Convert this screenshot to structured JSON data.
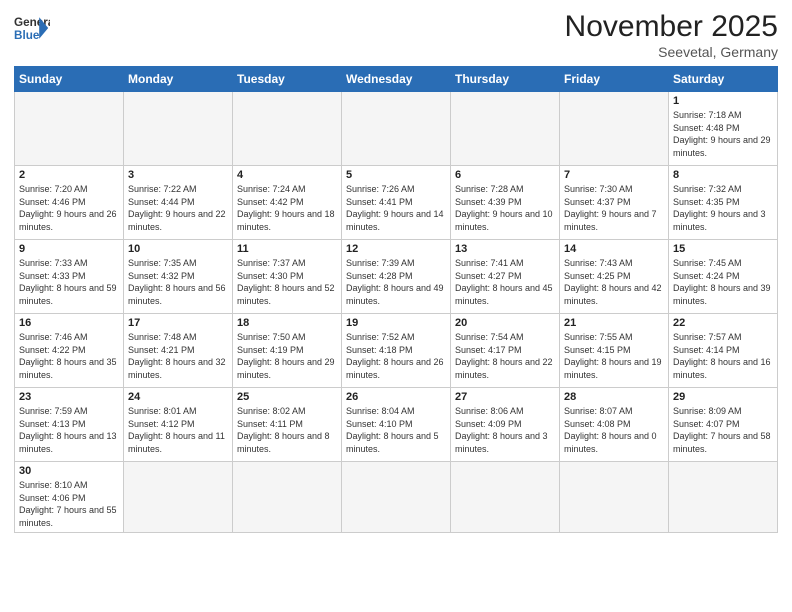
{
  "header": {
    "logo_general": "General",
    "logo_blue": "Blue",
    "month_title": "November 2025",
    "location": "Seevetal, Germany"
  },
  "days_of_week": [
    "Sunday",
    "Monday",
    "Tuesday",
    "Wednesday",
    "Thursday",
    "Friday",
    "Saturday"
  ],
  "weeks": [
    [
      {
        "day": "",
        "info": ""
      },
      {
        "day": "",
        "info": ""
      },
      {
        "day": "",
        "info": ""
      },
      {
        "day": "",
        "info": ""
      },
      {
        "day": "",
        "info": ""
      },
      {
        "day": "",
        "info": ""
      },
      {
        "day": "1",
        "info": "Sunrise: 7:18 AM\nSunset: 4:48 PM\nDaylight: 9 hours and 29 minutes."
      }
    ],
    [
      {
        "day": "2",
        "info": "Sunrise: 7:20 AM\nSunset: 4:46 PM\nDaylight: 9 hours and 26 minutes."
      },
      {
        "day": "3",
        "info": "Sunrise: 7:22 AM\nSunset: 4:44 PM\nDaylight: 9 hours and 22 minutes."
      },
      {
        "day": "4",
        "info": "Sunrise: 7:24 AM\nSunset: 4:42 PM\nDaylight: 9 hours and 18 minutes."
      },
      {
        "day": "5",
        "info": "Sunrise: 7:26 AM\nSunset: 4:41 PM\nDaylight: 9 hours and 14 minutes."
      },
      {
        "day": "6",
        "info": "Sunrise: 7:28 AM\nSunset: 4:39 PM\nDaylight: 9 hours and 10 minutes."
      },
      {
        "day": "7",
        "info": "Sunrise: 7:30 AM\nSunset: 4:37 PM\nDaylight: 9 hours and 7 minutes."
      },
      {
        "day": "8",
        "info": "Sunrise: 7:32 AM\nSunset: 4:35 PM\nDaylight: 9 hours and 3 minutes."
      }
    ],
    [
      {
        "day": "9",
        "info": "Sunrise: 7:33 AM\nSunset: 4:33 PM\nDaylight: 8 hours and 59 minutes."
      },
      {
        "day": "10",
        "info": "Sunrise: 7:35 AM\nSunset: 4:32 PM\nDaylight: 8 hours and 56 minutes."
      },
      {
        "day": "11",
        "info": "Sunrise: 7:37 AM\nSunset: 4:30 PM\nDaylight: 8 hours and 52 minutes."
      },
      {
        "day": "12",
        "info": "Sunrise: 7:39 AM\nSunset: 4:28 PM\nDaylight: 8 hours and 49 minutes."
      },
      {
        "day": "13",
        "info": "Sunrise: 7:41 AM\nSunset: 4:27 PM\nDaylight: 8 hours and 45 minutes."
      },
      {
        "day": "14",
        "info": "Sunrise: 7:43 AM\nSunset: 4:25 PM\nDaylight: 8 hours and 42 minutes."
      },
      {
        "day": "15",
        "info": "Sunrise: 7:45 AM\nSunset: 4:24 PM\nDaylight: 8 hours and 39 minutes."
      }
    ],
    [
      {
        "day": "16",
        "info": "Sunrise: 7:46 AM\nSunset: 4:22 PM\nDaylight: 8 hours and 35 minutes."
      },
      {
        "day": "17",
        "info": "Sunrise: 7:48 AM\nSunset: 4:21 PM\nDaylight: 8 hours and 32 minutes."
      },
      {
        "day": "18",
        "info": "Sunrise: 7:50 AM\nSunset: 4:19 PM\nDaylight: 8 hours and 29 minutes."
      },
      {
        "day": "19",
        "info": "Sunrise: 7:52 AM\nSunset: 4:18 PM\nDaylight: 8 hours and 26 minutes."
      },
      {
        "day": "20",
        "info": "Sunrise: 7:54 AM\nSunset: 4:17 PM\nDaylight: 8 hours and 22 minutes."
      },
      {
        "day": "21",
        "info": "Sunrise: 7:55 AM\nSunset: 4:15 PM\nDaylight: 8 hours and 19 minutes."
      },
      {
        "day": "22",
        "info": "Sunrise: 7:57 AM\nSunset: 4:14 PM\nDaylight: 8 hours and 16 minutes."
      }
    ],
    [
      {
        "day": "23",
        "info": "Sunrise: 7:59 AM\nSunset: 4:13 PM\nDaylight: 8 hours and 13 minutes."
      },
      {
        "day": "24",
        "info": "Sunrise: 8:01 AM\nSunset: 4:12 PM\nDaylight: 8 hours and 11 minutes."
      },
      {
        "day": "25",
        "info": "Sunrise: 8:02 AM\nSunset: 4:11 PM\nDaylight: 8 hours and 8 minutes."
      },
      {
        "day": "26",
        "info": "Sunrise: 8:04 AM\nSunset: 4:10 PM\nDaylight: 8 hours and 5 minutes."
      },
      {
        "day": "27",
        "info": "Sunrise: 8:06 AM\nSunset: 4:09 PM\nDaylight: 8 hours and 3 minutes."
      },
      {
        "day": "28",
        "info": "Sunrise: 8:07 AM\nSunset: 4:08 PM\nDaylight: 8 hours and 0 minutes."
      },
      {
        "day": "29",
        "info": "Sunrise: 8:09 AM\nSunset: 4:07 PM\nDaylight: 7 hours and 58 minutes."
      }
    ],
    [
      {
        "day": "30",
        "info": "Sunrise: 8:10 AM\nSunset: 4:06 PM\nDaylight: 7 hours and 55 minutes."
      },
      {
        "day": "",
        "info": ""
      },
      {
        "day": "",
        "info": ""
      },
      {
        "day": "",
        "info": ""
      },
      {
        "day": "",
        "info": ""
      },
      {
        "day": "",
        "info": ""
      },
      {
        "day": "",
        "info": ""
      }
    ]
  ]
}
